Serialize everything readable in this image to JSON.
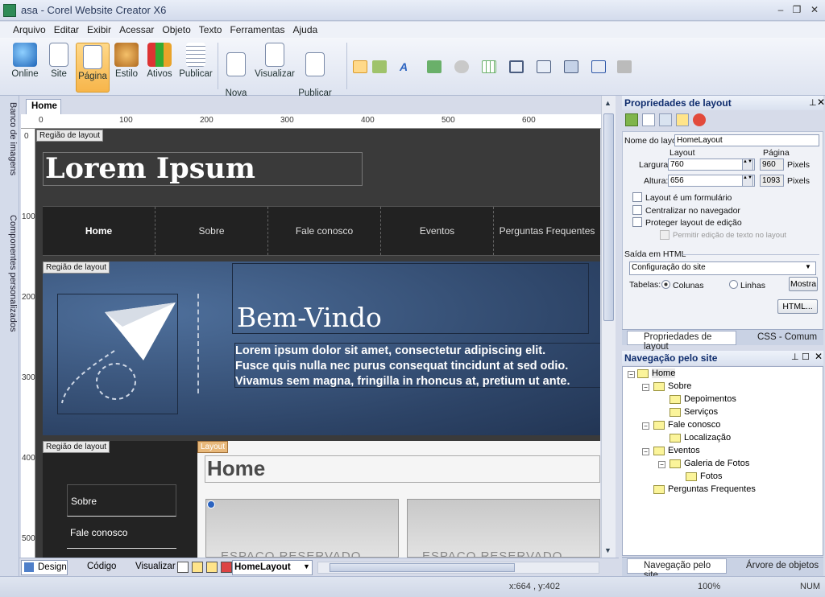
{
  "window": {
    "title": "asa - Corel Website Creator X6"
  },
  "menu": [
    "Arquivo",
    "Editar",
    "Exibir",
    "Acessar",
    "Objeto",
    "Texto",
    "Ferramentas",
    "Ajuda"
  ],
  "ribbon": {
    "buttons": [
      {
        "label": "Online",
        "icon": "globe-icon"
      },
      {
        "label": "Site",
        "icon": "sitemap-icon"
      },
      {
        "label": "Página",
        "icon": "page-edit-icon"
      },
      {
        "label": "Estilo",
        "icon": "palette-icon"
      },
      {
        "label": "Ativos",
        "icon": "assets-icon"
      },
      {
        "label": "Publicar",
        "icon": "stack-icon"
      },
      {
        "label": "Nova\npágina",
        "icon": "new-page-icon"
      },
      {
        "label": "Visualizar",
        "icon": "preview-icon"
      },
      {
        "label": "Publicar\nsite",
        "icon": "publish-site-icon"
      }
    ]
  },
  "left_tabs": [
    "Banco de imagens",
    "Componentes personalizados"
  ],
  "doc_tab": "Home",
  "ruler": {
    "h": [
      "0",
      "100",
      "200",
      "300",
      "400",
      "500",
      "600"
    ],
    "v": [
      "0",
      "100",
      "200",
      "300",
      "400",
      "500"
    ]
  },
  "canvas": {
    "region_label": "Região de layout",
    "layout_label": "Layout",
    "site_title": "Lorem Ipsum",
    "nav": [
      "Home",
      "Sobre",
      "Fale conosco",
      "Eventos",
      "Perguntas Frequentes"
    ],
    "hero_title": "Bem-Vindo",
    "hero_text": [
      "Lorem ipsum dolor sit amet, consectetur adipiscing elit.",
      "Fusce quis nulla nec purus consequat tincidunt at sed odio.",
      "Vivamus sem magna, fringilla in rhoncus at, pretium ut ante."
    ],
    "side_nav": [
      "Sobre",
      "Fale conosco"
    ],
    "page_heading": "Home",
    "placeholder": "ESPAÇO RESERVADO"
  },
  "bottom_bar": {
    "design": "Design",
    "code": "Código",
    "preview": "Visualizar",
    "layout_select": "HomeLayout"
  },
  "status": {
    "coords": "x:664 , y:402",
    "zoom": "100%",
    "num": "NUM"
  },
  "props_panel": {
    "title": "Propriedades de layout",
    "name_label": "Nome do layout",
    "name_value": "HomeLayout",
    "col_layout": "Layout",
    "col_page": "Página",
    "width_label": "Largura:",
    "width_value": "760",
    "width_page": "960",
    "height_label": "Altura:",
    "height_value": "656",
    "height_page": "1093",
    "units": "Pixels",
    "checks": [
      "Layout é um formulário",
      "Centralizar no navegador",
      "Proteger layout de edição",
      "Permitir edição de texto no layout"
    ],
    "html_output": "Saída em HTML",
    "config": "Configuração do site",
    "tables_label": "Tabelas:",
    "radio_cols": "Colunas",
    "radio_lines": "Linhas",
    "show_btn": "Mostra",
    "html_btn": "HTML...",
    "tab1": "Propriedades de layout",
    "tab2": "CSS - Comum"
  },
  "nav_panel": {
    "title": "Navegação pelo site",
    "tree": [
      {
        "label": "Home",
        "level": 0
      },
      {
        "label": "Sobre",
        "level": 1
      },
      {
        "label": "Depoimentos",
        "level": 2
      },
      {
        "label": "Serviços",
        "level": 2
      },
      {
        "label": "Fale conosco",
        "level": 1
      },
      {
        "label": "Localização",
        "level": 2
      },
      {
        "label": "Eventos",
        "level": 1
      },
      {
        "label": "Galeria de Fotos",
        "level": 2
      },
      {
        "label": "Fotos",
        "level": 3
      },
      {
        "label": "Perguntas Frequentes",
        "level": 1
      }
    ],
    "tab1": "Navegação pelo site",
    "tab2": "Árvore de objetos"
  }
}
